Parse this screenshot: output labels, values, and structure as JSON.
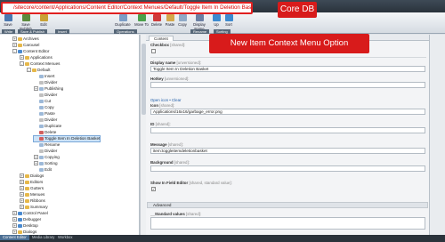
{
  "path_callout": "/sitecore/content/Applications/Content Editor/Context Menues/Default/Toggle Item In Deletion Basket",
  "db_callout": "Core DB",
  "item_callout": "New Item Context Menu Option",
  "ribbon": {
    "buttons": [
      "Save",
      "Save Publish",
      "Edit",
      "Duplicate",
      "Move To",
      "Delete",
      "Paste",
      "Copy",
      "Display Name",
      "Move",
      "Up",
      "Sort"
    ],
    "groups": [
      "Write",
      "Save & Publish",
      "Insert",
      "Operations",
      "Rename",
      "Sorting"
    ]
  },
  "tree": {
    "nodes": [
      {
        "label": "Archives",
        "depth": 1,
        "expander": "+",
        "color": "#e6b84a"
      },
      {
        "label": "Carousel",
        "depth": 1,
        "expander": "+",
        "color": "#e6b84a"
      },
      {
        "label": "Content Editor",
        "depth": 1,
        "expander": "-",
        "color": "#4a8ad0"
      },
      {
        "label": "Applications",
        "depth": 2,
        "expander": "+",
        "color": "#e6b84a"
      },
      {
        "label": "Context Menues",
        "depth": 2,
        "expander": "-",
        "color": "#e6b84a"
      },
      {
        "label": "Default",
        "depth": 3,
        "expander": "-",
        "color": "#e6b84a"
      },
      {
        "label": "Insert",
        "depth": 4,
        "expander": "",
        "color": "#9db9d8"
      },
      {
        "label": "Divider",
        "depth": 4,
        "expander": "",
        "color": "#c0c0c0"
      },
      {
        "label": "Publishing",
        "depth": 4,
        "expander": "+",
        "color": "#9db9d8"
      },
      {
        "label": "Divider",
        "depth": 4,
        "expander": "",
        "color": "#c0c0c0"
      },
      {
        "label": "Cut",
        "depth": 4,
        "expander": "",
        "color": "#9db9d8"
      },
      {
        "label": "Copy",
        "depth": 4,
        "expander": "",
        "color": "#9db9d8"
      },
      {
        "label": "Paste",
        "depth": 4,
        "expander": "",
        "color": "#9db9d8"
      },
      {
        "label": "Divider",
        "depth": 4,
        "expander": "",
        "color": "#c0c0c0"
      },
      {
        "label": "Duplicate",
        "depth": 4,
        "expander": "",
        "color": "#9db9d8"
      },
      {
        "label": "Delete",
        "depth": 4,
        "expander": "",
        "color": "#d06060"
      },
      {
        "label": "Toggle Item In Deletion Basket",
        "depth": 4,
        "expander": "",
        "color": "#d06060",
        "selected": true
      },
      {
        "label": "Rename",
        "depth": 4,
        "expander": "",
        "color": "#9db9d8"
      },
      {
        "label": "Divider",
        "depth": 4,
        "expander": "",
        "color": "#c0c0c0"
      },
      {
        "label": "Copying",
        "depth": 4,
        "expander": "+",
        "color": "#9db9d8"
      },
      {
        "label": "Sorting",
        "depth": 4,
        "expander": "+",
        "color": "#9db9d8"
      },
      {
        "label": "Edit",
        "depth": 4,
        "expander": "",
        "color": "#9db9d8"
      },
      {
        "label": "Dialogs",
        "depth": 2,
        "expander": "+",
        "color": "#e6b84a"
      },
      {
        "label": "Editors",
        "depth": 2,
        "expander": "+",
        "color": "#e6b84a"
      },
      {
        "label": "Gutters",
        "depth": 2,
        "expander": "+",
        "color": "#e6b84a"
      },
      {
        "label": "Menues",
        "depth": 2,
        "expander": "+",
        "color": "#e6b84a"
      },
      {
        "label": "Ribbons",
        "depth": 2,
        "expander": "+",
        "color": "#e6b84a"
      },
      {
        "label": "Summary",
        "depth": 2,
        "expander": "+",
        "color": "#e6b84a"
      },
      {
        "label": "Control Panel",
        "depth": 1,
        "expander": "+",
        "color": "#4a8ad0"
      },
      {
        "label": "Debugger",
        "depth": 1,
        "expander": "+",
        "color": "#4a8ad0"
      },
      {
        "label": "Desktop",
        "depth": 1,
        "expander": "+",
        "color": "#4a8ad0"
      },
      {
        "label": "Dialogs",
        "depth": 1,
        "expander": "+",
        "color": "#e6b84a"
      }
    ]
  },
  "editor": {
    "tab": "Content",
    "checkbox_label": "Checkbox",
    "checkbox_shared": "[shared]:",
    "display_name_label": "Display name",
    "display_name_shared": "[unversioned]:",
    "display_name_value": "Toggle Item In Deletion Basket",
    "hotkey_label": "Hotkey",
    "hotkey_shared": "[unversioned]:",
    "icon_links": "Open icon  •  Clear",
    "icon_label": "Icon",
    "icon_shared": "[shared]:",
    "icon_value": "Applications/16x16/garbage_error.png",
    "id_label": "ID",
    "id_shared": "[shared]:",
    "message_label": "Message",
    "message_shared": "[shared]:",
    "message_value": "item:toggleitemdeletionbasket",
    "background_label": "Background",
    "background_shared": "[shared]:",
    "show_in_field_editor_label": "Show In Field Editor",
    "show_in_field_editor_shared": "[shared, standard value]:",
    "advanced_section": "Advanced",
    "standard_values_label": "__Standard values",
    "standard_values_shared": "[shared]:"
  },
  "bottom_tabs": [
    "Content Editor",
    "Media Library",
    "Workbox"
  ]
}
